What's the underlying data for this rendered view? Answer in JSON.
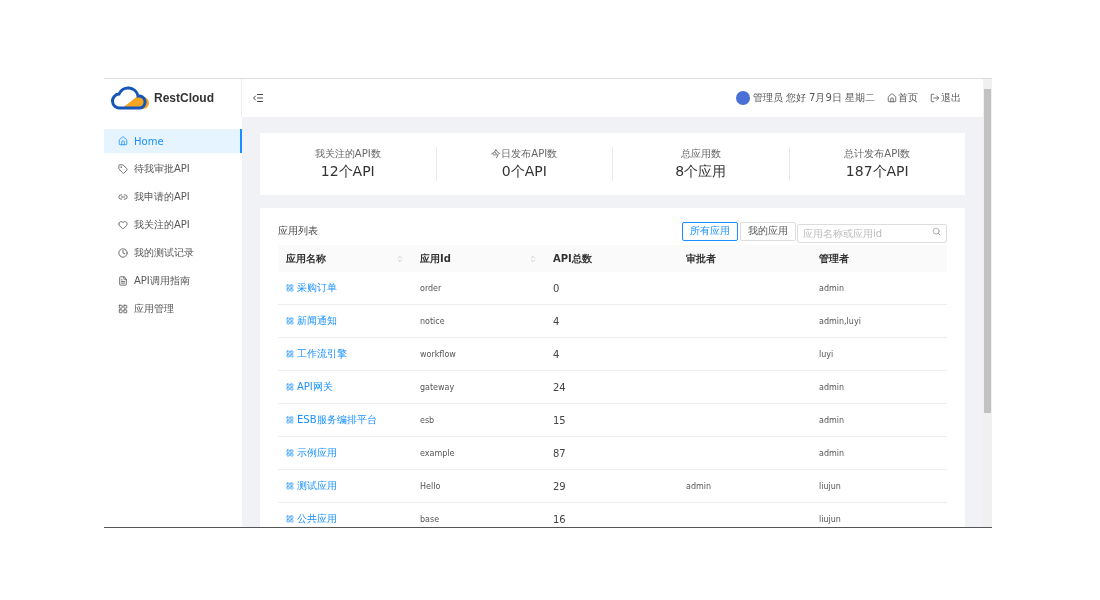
{
  "header": {
    "brand": "RestCloud",
    "user_greeting": "管理员 您好 7月9日 星期二",
    "links": [
      {
        "label": "首页",
        "kind": "home"
      },
      {
        "label": "退出",
        "kind": "logout"
      }
    ]
  },
  "sidebar": {
    "items": [
      {
        "label": "Home",
        "kind": "home",
        "selected": true
      },
      {
        "label": "待我审批API",
        "kind": "tag",
        "selected": false
      },
      {
        "label": "我申请的API",
        "kind": "link",
        "selected": false
      },
      {
        "label": "我关注的API",
        "kind": "heart",
        "selected": false
      },
      {
        "label": "我的测试记录",
        "kind": "clock",
        "selected": false
      },
      {
        "label": "API调用指南",
        "kind": "file",
        "selected": false
      },
      {
        "label": "应用管理",
        "kind": "apps",
        "selected": false
      }
    ]
  },
  "stats": [
    {
      "label": "我关注的API数",
      "value": "12个API"
    },
    {
      "label": "今日发布API数",
      "value": "0个API"
    },
    {
      "label": "总应用数",
      "value": "8个应用"
    },
    {
      "label": "总计发布API数",
      "value": "187个API"
    }
  ],
  "app_list": {
    "title": "应用列表",
    "filters": [
      {
        "label": "所有应用",
        "selected": true
      },
      {
        "label": "我的应用",
        "selected": false
      }
    ],
    "search": {
      "placeholder": "应用名称或应用id"
    },
    "columns": [
      {
        "label": "应用名称",
        "sortable": true
      },
      {
        "label": "应用Id",
        "sortable": true
      },
      {
        "label": "API总数",
        "sortable": false
      },
      {
        "label": "审批者",
        "sortable": false
      },
      {
        "label": "管理者",
        "sortable": false
      }
    ],
    "rows": [
      {
        "name": "采购订单",
        "id": "order",
        "api_count": "0",
        "manager": "admin"
      },
      {
        "name": "新闻通知",
        "id": "notice",
        "api_count": "4",
        "manager": "admin,luyi"
      },
      {
        "name": "工作流引擎",
        "id": "workflow",
        "api_count": "4",
        "manager": "luyi"
      },
      {
        "name": "API网关",
        "id": "gateway",
        "api_count": "24",
        "manager": "admin"
      },
      {
        "name": "ESB服务编排平台",
        "id": "esb",
        "api_count": "15",
        "manager": "admin"
      },
      {
        "name": "示例应用",
        "id": "example",
        "api_count": "87",
        "manager": "admin"
      },
      {
        "name": "测试应用",
        "id": "Hello",
        "api_count": "29",
        "approver": "admin",
        "manager": "liujun"
      },
      {
        "name": "公共应用",
        "id": "base",
        "api_count": "16",
        "manager": "liujun"
      }
    ]
  }
}
